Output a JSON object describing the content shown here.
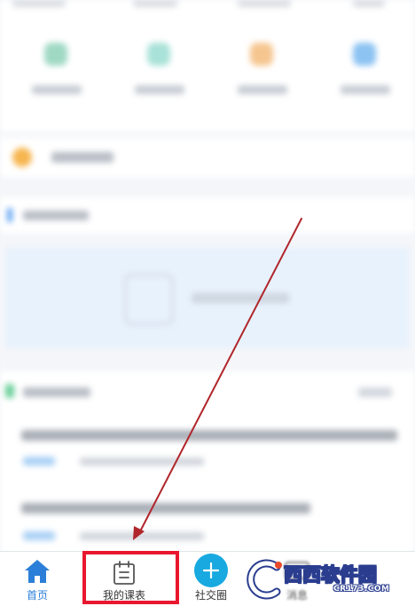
{
  "tabbar": {
    "tabs": [
      {
        "label": "首页",
        "icon": "home-icon",
        "active": true
      },
      {
        "label": "我的课表",
        "icon": "calendar-icon",
        "active": false
      },
      {
        "label": "社交圈",
        "icon": "plus-icon",
        "active": false
      },
      {
        "label": "消息",
        "icon": "message-icon",
        "active": false
      }
    ]
  },
  "colors": {
    "accent": "#2b7fd8",
    "social_button": "#17a9e0",
    "highlight_box": "#e8172f",
    "annotation_arrow": "#b0262b"
  },
  "watermark": {
    "logo_text": "西西软件园",
    "sub_text": "CR173.COM"
  }
}
